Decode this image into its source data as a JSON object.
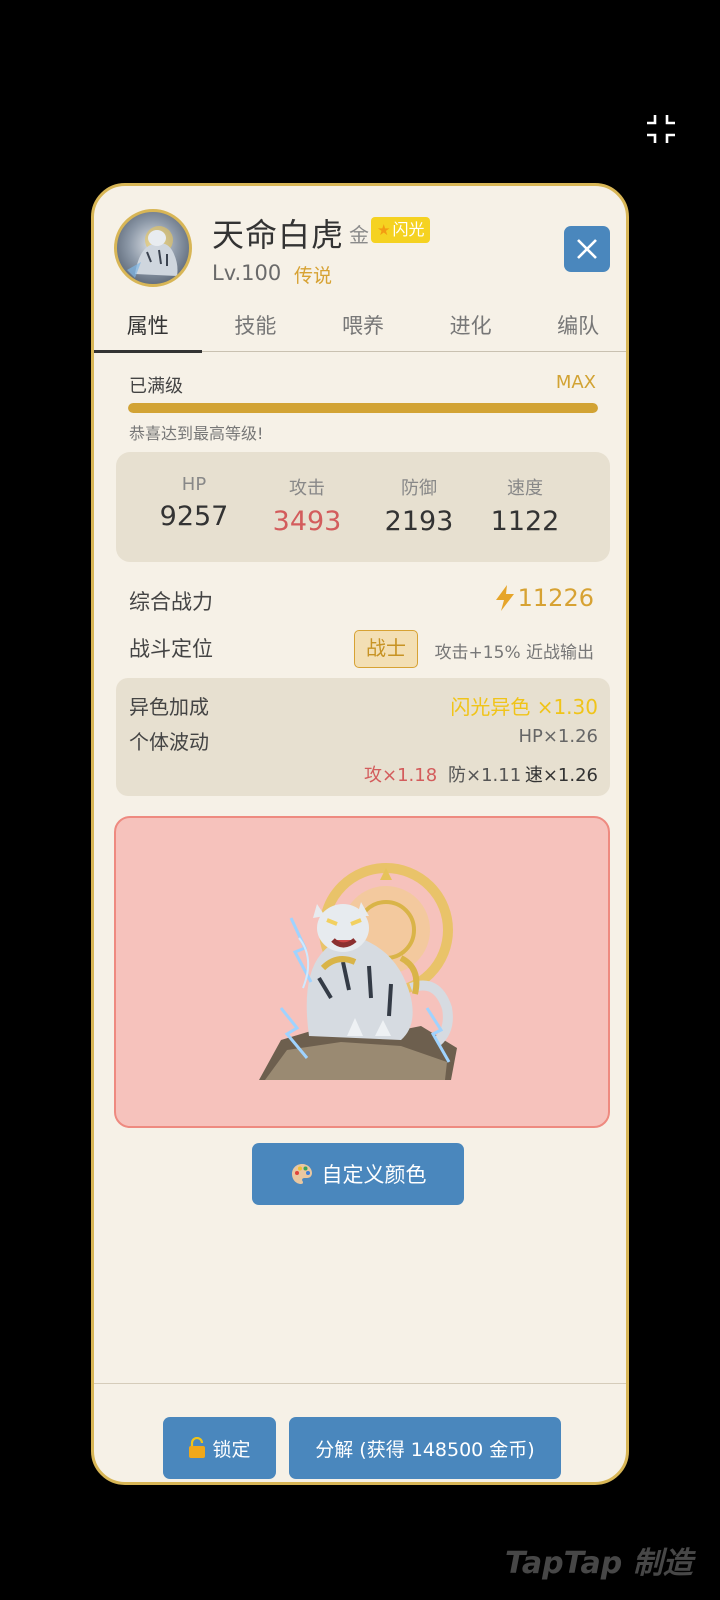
{
  "pet": {
    "name": "天命白虎",
    "grade": "金",
    "shiny_badge": "闪光",
    "level": "Lv.100",
    "rarity": "传说"
  },
  "tabs": [
    "属性",
    "技能",
    "喂养",
    "进化",
    "编队"
  ],
  "level_status": {
    "label": "已满级",
    "tag": "MAX",
    "progress_percent": 100,
    "message": "恭喜达到最高等级!"
  },
  "stats": [
    {
      "label": "HP",
      "value": "9257"
    },
    {
      "label": "攻击",
      "value": "3493"
    },
    {
      "label": "防御",
      "value": "2193"
    },
    {
      "label": "速度",
      "value": "1122"
    }
  ],
  "power": {
    "label": "综合战力",
    "value": "11226"
  },
  "role": {
    "label": "战斗定位",
    "badge": "战士",
    "desc": "攻击+15% 近战输出"
  },
  "bonus": {
    "variant_label": "异色加成",
    "variant_value": "闪光异色 ×1.30",
    "individual_label": "个体波动",
    "hp": "HP×1.26",
    "atk": "攻×1.18",
    "def": "防×1.11",
    "spd": "速×1.26"
  },
  "preview": {
    "background_color": "#f6c2bc",
    "border_color": "#ee8a80"
  },
  "buttons": {
    "custom_color": "自定义颜色",
    "lock": "锁定",
    "decompose": "分解 (获得 148500 金币)"
  },
  "watermark": "TapTap 制造",
  "colors": {
    "accent": "#4a87bd",
    "gold": "#d7a233",
    "red": "#d35c5c"
  }
}
